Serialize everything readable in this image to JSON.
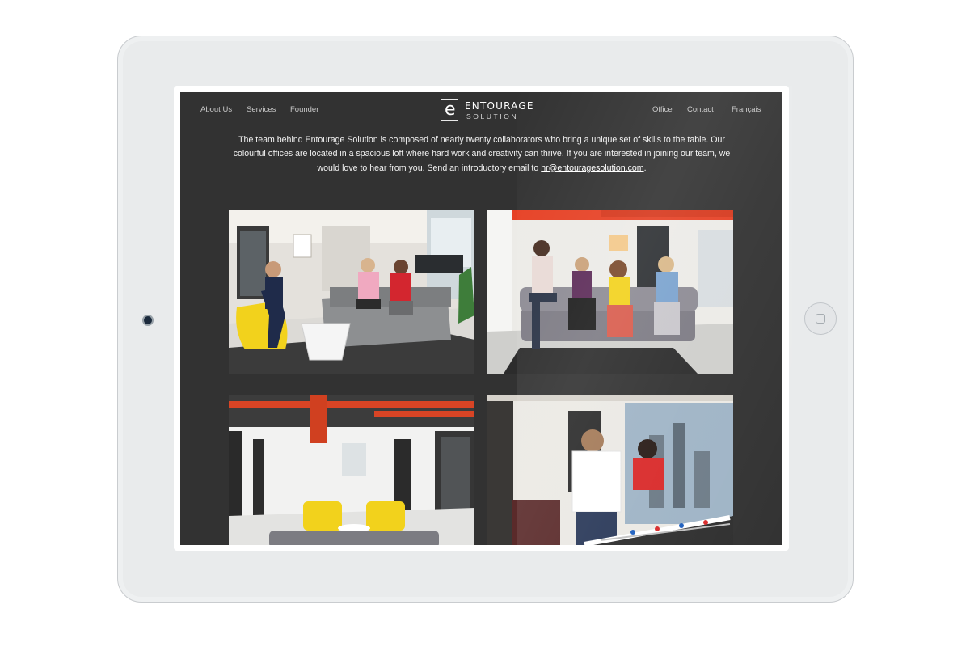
{
  "nav": {
    "left": [
      "About Us",
      "Services",
      "Founder"
    ],
    "right": [
      "Office",
      "Contact",
      "Français"
    ]
  },
  "logo": {
    "top": "ENTOURAGE",
    "bottom": "SOLUTION"
  },
  "intro": {
    "text": "The team behind Entourage Solution is composed of nearly twenty collaborators who bring a unique set of skills to the table. Our colourful offices are located in a spacious loft where hard work and creativity can thrive. If you are interested in joining our team, we would love to hear from you. Send an introductory email to",
    "email": "hr@entouragesolution.com",
    "after": "."
  },
  "colors": {
    "page_bg": "#323232",
    "tablet_body": "#e9ebec",
    "accent_yellow": "#f2d21c",
    "accent_red": "#d8401f"
  }
}
